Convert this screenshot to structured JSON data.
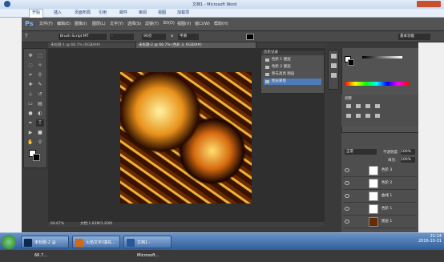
{
  "word": {
    "title": "文档1 - Microsoft Word",
    "tabs": [
      "开始",
      "插入",
      "页面布局",
      "引用",
      "邮件",
      "审阅",
      "视图",
      "加载项"
    ]
  },
  "ps": {
    "menu": [
      "文件(F)",
      "编辑(E)",
      "图像(I)",
      "图层(L)",
      "文字(Y)",
      "选择(S)",
      "滤镜(T)",
      "3D(D)",
      "视图(V)",
      "窗口(W)",
      "帮助(H)"
    ],
    "options": {
      "font_family": "Brush Script MT",
      "font_style": "-",
      "font_size": "90点",
      "aa": "a",
      "aa_mode": "平滑",
      "workspace": "基本功能"
    },
    "doc_tabs": [
      "未标题-1 @ 66.7% (RGB/8#)",
      "未标题-2 @ 66.7% (色彩 3, RGB/8#)"
    ],
    "status": {
      "zoom": "66.67%",
      "doc": "文档:1.83M/1.83M"
    },
    "history": {
      "title": "历史记录",
      "items": [
        "色阶 1 图层",
        "色阶 2 图层",
        "移去高亮 图层",
        "图层蒙版"
      ]
    },
    "layers": {
      "blend": "正常",
      "opacity_label": "不透明度:",
      "opacity": "100%",
      "fill_label": "填充:",
      "fill": "100%",
      "rows": [
        "色阶 3",
        "色阶 2",
        "曲线 1",
        "色阶 1",
        "图层 1"
      ]
    },
    "panel_title": "调整"
  },
  "taskbar": {
    "items": [
      "未标题-2 @ 66.7...",
      "火焰文字(填充...",
      "文档1 - Microsoft..."
    ],
    "time": "21:14",
    "date": "2016-10-31"
  },
  "colors": {
    "accent": "#4f7bb8",
    "word_blue": "#1e3a66"
  }
}
